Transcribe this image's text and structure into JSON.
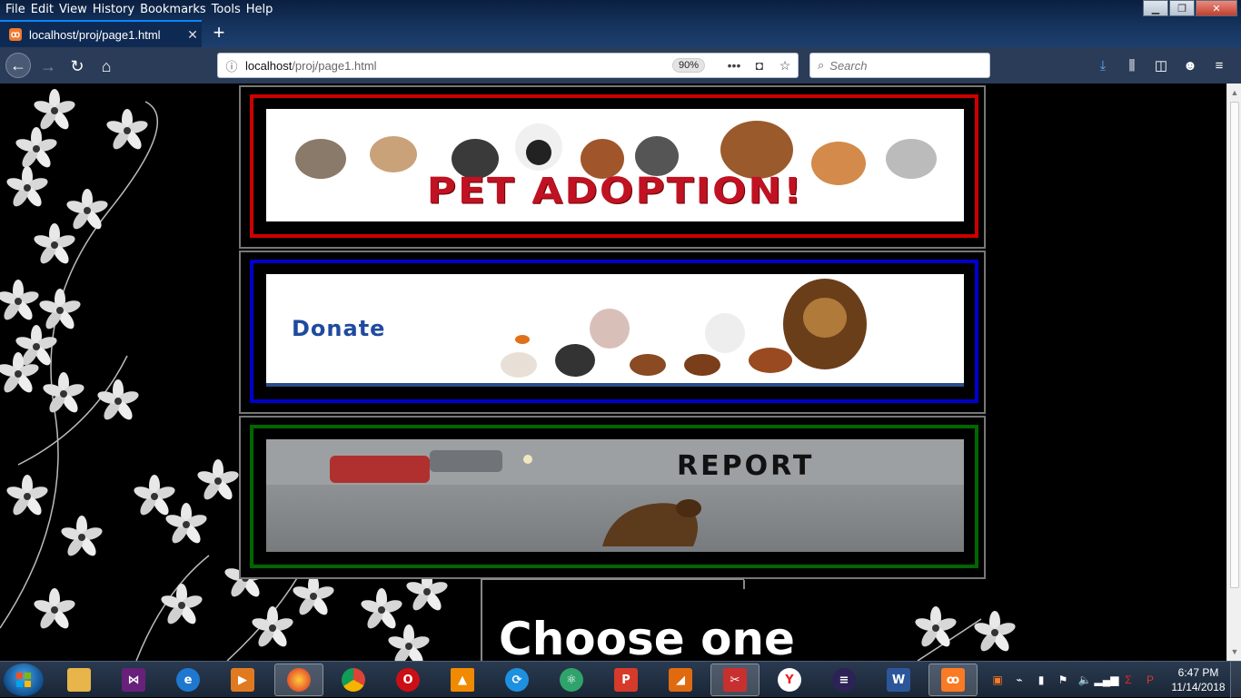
{
  "menu": [
    "File",
    "Edit",
    "View",
    "History",
    "Bookmarks",
    "Tools",
    "Help"
  ],
  "tab": {
    "title": "localhost/proj/page1.html",
    "close": "✕"
  },
  "new_tab": "+",
  "url": {
    "host": "localhost",
    "path": "/proj/page1.html",
    "zoom": "90%"
  },
  "search": {
    "placeholder": "Search"
  },
  "banners": {
    "adopt": "PET ADOPTION!",
    "donate": "Donate",
    "report": "REPORT"
  },
  "choose": "Choose one",
  "clock": {
    "time": "6:47 PM",
    "date": "11/14/2018"
  },
  "colors": {
    "adopt_frame": "#cc0000",
    "donate_frame": "#0000cc",
    "report_frame": "#006600"
  }
}
